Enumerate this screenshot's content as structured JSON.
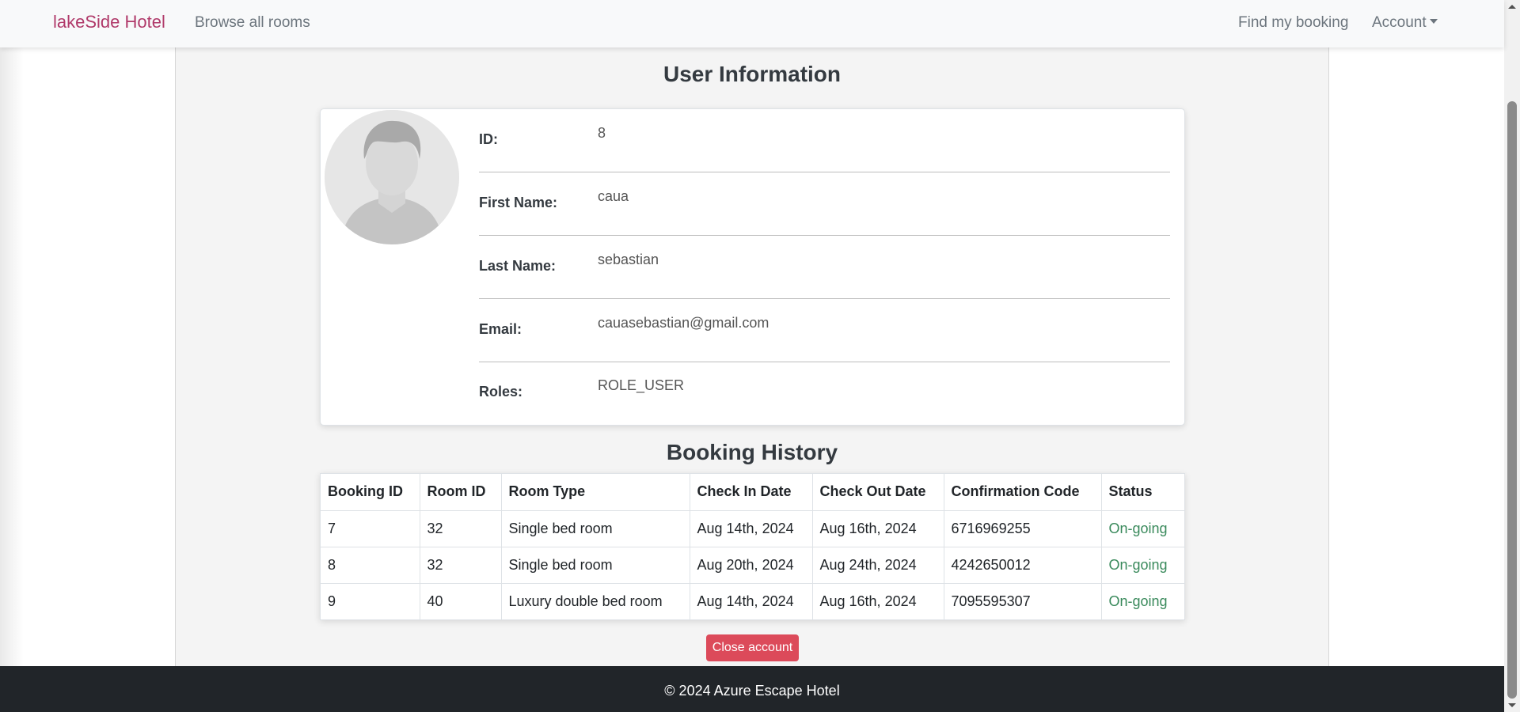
{
  "navbar": {
    "brand": "lakeSide Hotel",
    "browse_rooms": "Browse all rooms",
    "find_booking": "Find my booking",
    "account": "Account"
  },
  "user_info": {
    "title": "User Information",
    "fields": [
      {
        "label": "ID:",
        "value": "8"
      },
      {
        "label": "First Name:",
        "value": "caua"
      },
      {
        "label": "Last Name:",
        "value": "sebastian"
      },
      {
        "label": "Email:",
        "value": "cauasebastian@gmail.com"
      },
      {
        "label": "Roles:",
        "value": "ROLE_USER"
      }
    ]
  },
  "booking_history": {
    "title": "Booking History",
    "columns": [
      "Booking ID",
      "Room ID",
      "Room Type",
      "Check In Date",
      "Check Out Date",
      "Confirmation Code",
      "Status"
    ],
    "rows": [
      [
        "7",
        "32",
        "Single bed room",
        "Aug 14th, 2024",
        "Aug 16th, 2024",
        "6716969255",
        "On-going"
      ],
      [
        "8",
        "32",
        "Single bed room",
        "Aug 20th, 2024",
        "Aug 24th, 2024",
        "4242650012",
        "On-going"
      ],
      [
        "9",
        "40",
        "Luxury double bed room",
        "Aug 14th, 2024",
        "Aug 16th, 2024",
        "7095595307",
        "On-going"
      ]
    ]
  },
  "close_account_label": "Close account",
  "footer": {
    "text": "© 2024 Azure Escape Hotel"
  },
  "colors": {
    "brand": "#b03a6a",
    "danger": "#dc4a5a",
    "status_ongoing": "#3a8a5c",
    "footer_bg": "#212529"
  }
}
